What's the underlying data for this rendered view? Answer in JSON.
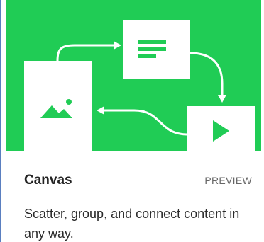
{
  "card": {
    "title": "Canvas",
    "badge": "PREVIEW",
    "description": "Scatter, group, and connect content in any way."
  },
  "colors": {
    "hero_background": "#20cc55",
    "panel": "#ffffff",
    "accent_green": "#20cc55",
    "left_border": "#5a7fc0"
  },
  "icons": {
    "hero_left_panel": "image-icon",
    "hero_top_panel": "text-lines-icon",
    "hero_bottom_panel": "play-icon",
    "flow": "curved-arrow-icon"
  }
}
